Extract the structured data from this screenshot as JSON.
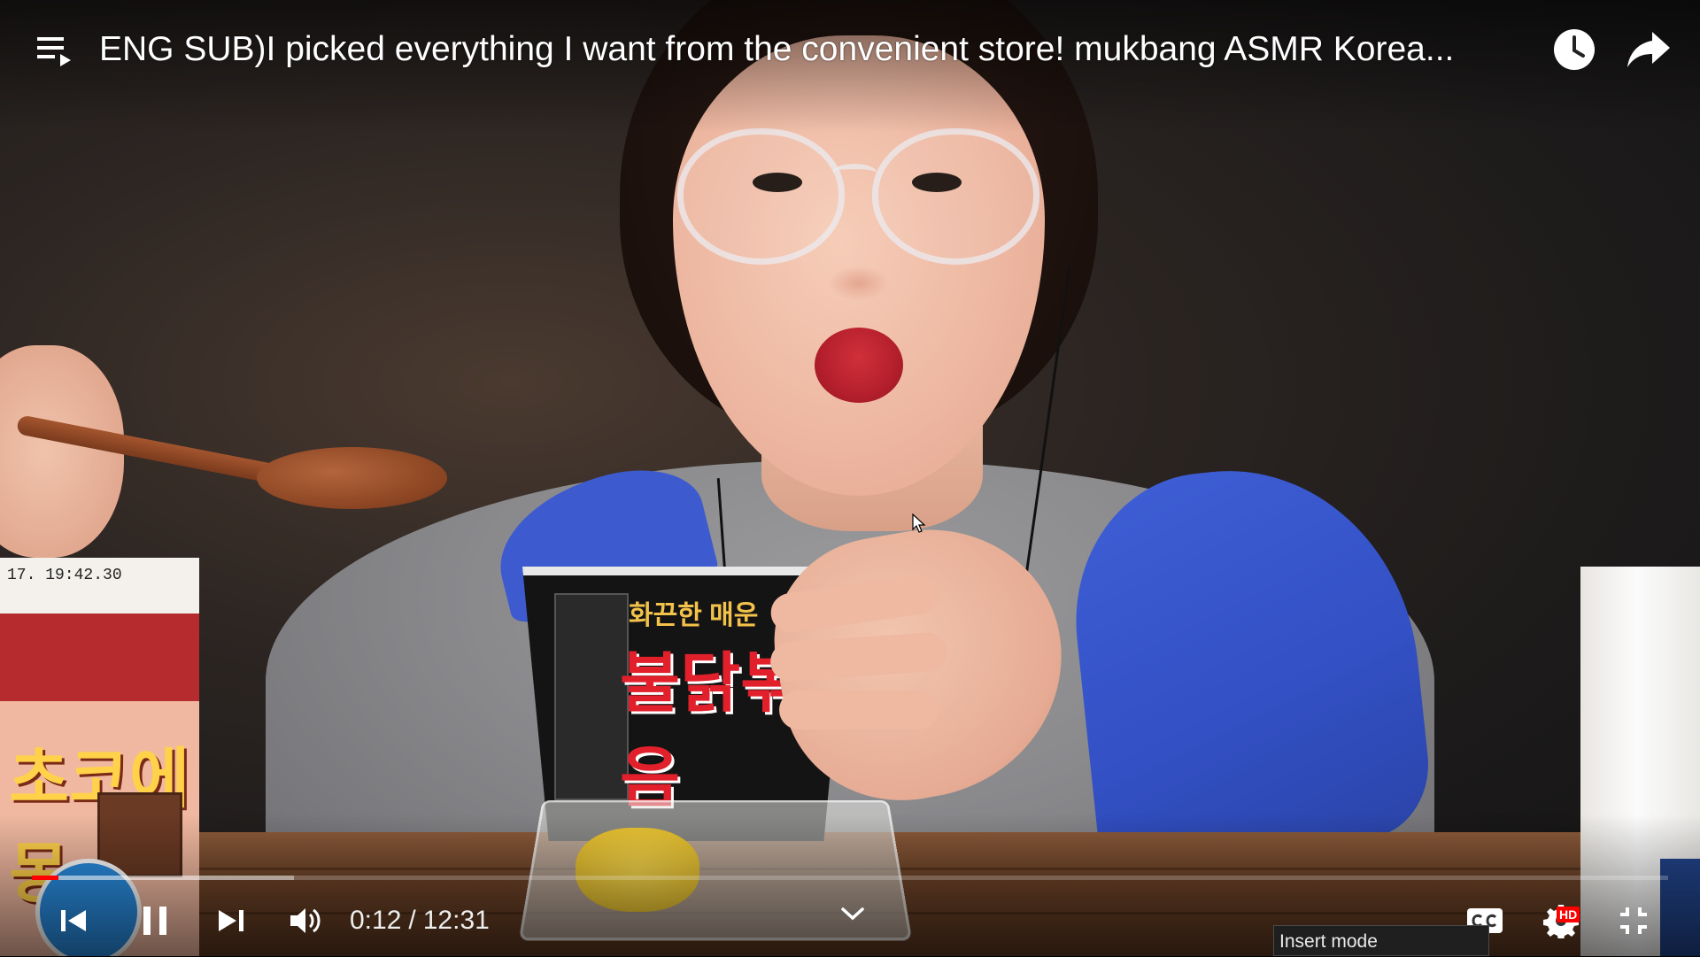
{
  "video": {
    "title": "ENG SUB)I picked everything I want from the convenient store! mukbang ASMR Korea...",
    "progress_played_fraction": 0.016,
    "progress_loaded_fraction": 0.16
  },
  "player": {
    "current_time": "0:12",
    "time_separator": "/",
    "duration": "12:31",
    "quality_badge": "HD",
    "accent_color": "#ff0000"
  },
  "scene": {
    "cup_label_top": "화끈한 매운",
    "cup_label_main": "불닭볶음",
    "milk_carton_date": "17. 19:42.30",
    "milk_carton_brand": "초코에 몽"
  },
  "icons": {
    "playlist": "playlist-icon",
    "watch_later": "clock-icon",
    "share": "share-arrow-icon",
    "previous": "skip-previous-icon",
    "pause": "pause-icon",
    "next": "skip-next-icon",
    "volume": "volume-icon",
    "captions": "captions-icon",
    "settings": "gear-icon",
    "fullscreen_exit": "fullscreen-exit-icon"
  },
  "status_bar": {
    "mode": "Insert mode"
  }
}
